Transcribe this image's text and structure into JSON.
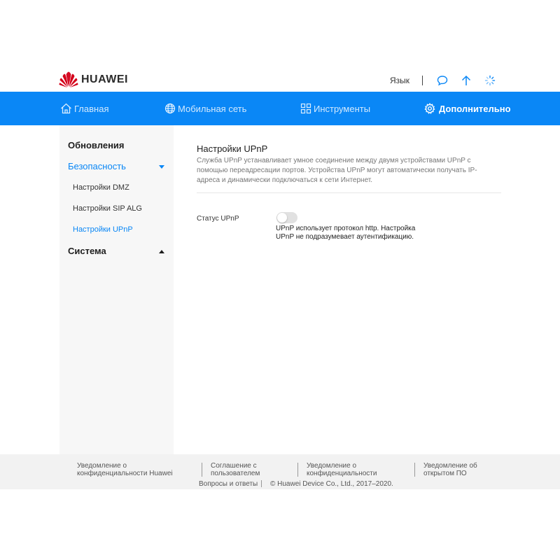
{
  "header": {
    "brand": "HUAWEI",
    "language_label": "Язык",
    "icons": [
      "message-icon",
      "update-arrow-icon",
      "loading-spinner-icon"
    ]
  },
  "nav": {
    "items": [
      {
        "label": "Главная",
        "icon": "home-icon"
      },
      {
        "label": "Мобильная сеть",
        "icon": "globe-icon"
      },
      {
        "label": "Инструменты",
        "icon": "tools-grid-icon"
      },
      {
        "label": "Дополнительно",
        "icon": "gear-icon",
        "active": true
      }
    ]
  },
  "sidebar": {
    "groups": [
      {
        "label": "Обновления"
      },
      {
        "label": "Безопасность",
        "expanded": true,
        "items": [
          {
            "label": "Настройки DMZ"
          },
          {
            "label": "Настройки SIP ALG"
          },
          {
            "label": "Настройки UPnP",
            "active": true
          }
        ]
      },
      {
        "label": "Система",
        "expanded": false
      }
    ]
  },
  "main": {
    "title": "Настройки UPnP",
    "description": "Служба UPnP устанавливает умное соединение между двумя устройствами UPnP с помощью переадресации портов. Устройства UPnP могут автоматически получать IP-адреса и динамически подключаться к сети Интернет.",
    "upnp_status_label": "Статус UPnP",
    "upnp_enabled": false,
    "upnp_note": "UPnP использует протокол http. Настройка UPnP не подразумевает аутентификацию."
  },
  "footer": {
    "links": [
      "Уведомление о конфиденциальности Huawei",
      "Соглашение с пользователем",
      "Уведомление о конфиденциальности",
      "Уведомление об открытом ПО",
      "Вопросы и ответы"
    ],
    "copyright": "© Huawei Device Co., Ltd., 2017–2020."
  },
  "colors": {
    "accent": "#0a87f6",
    "brand_red": "#d4001a",
    "footer_bg": "#f2f2f2",
    "sidebar_bg": "#f7f7f7"
  }
}
